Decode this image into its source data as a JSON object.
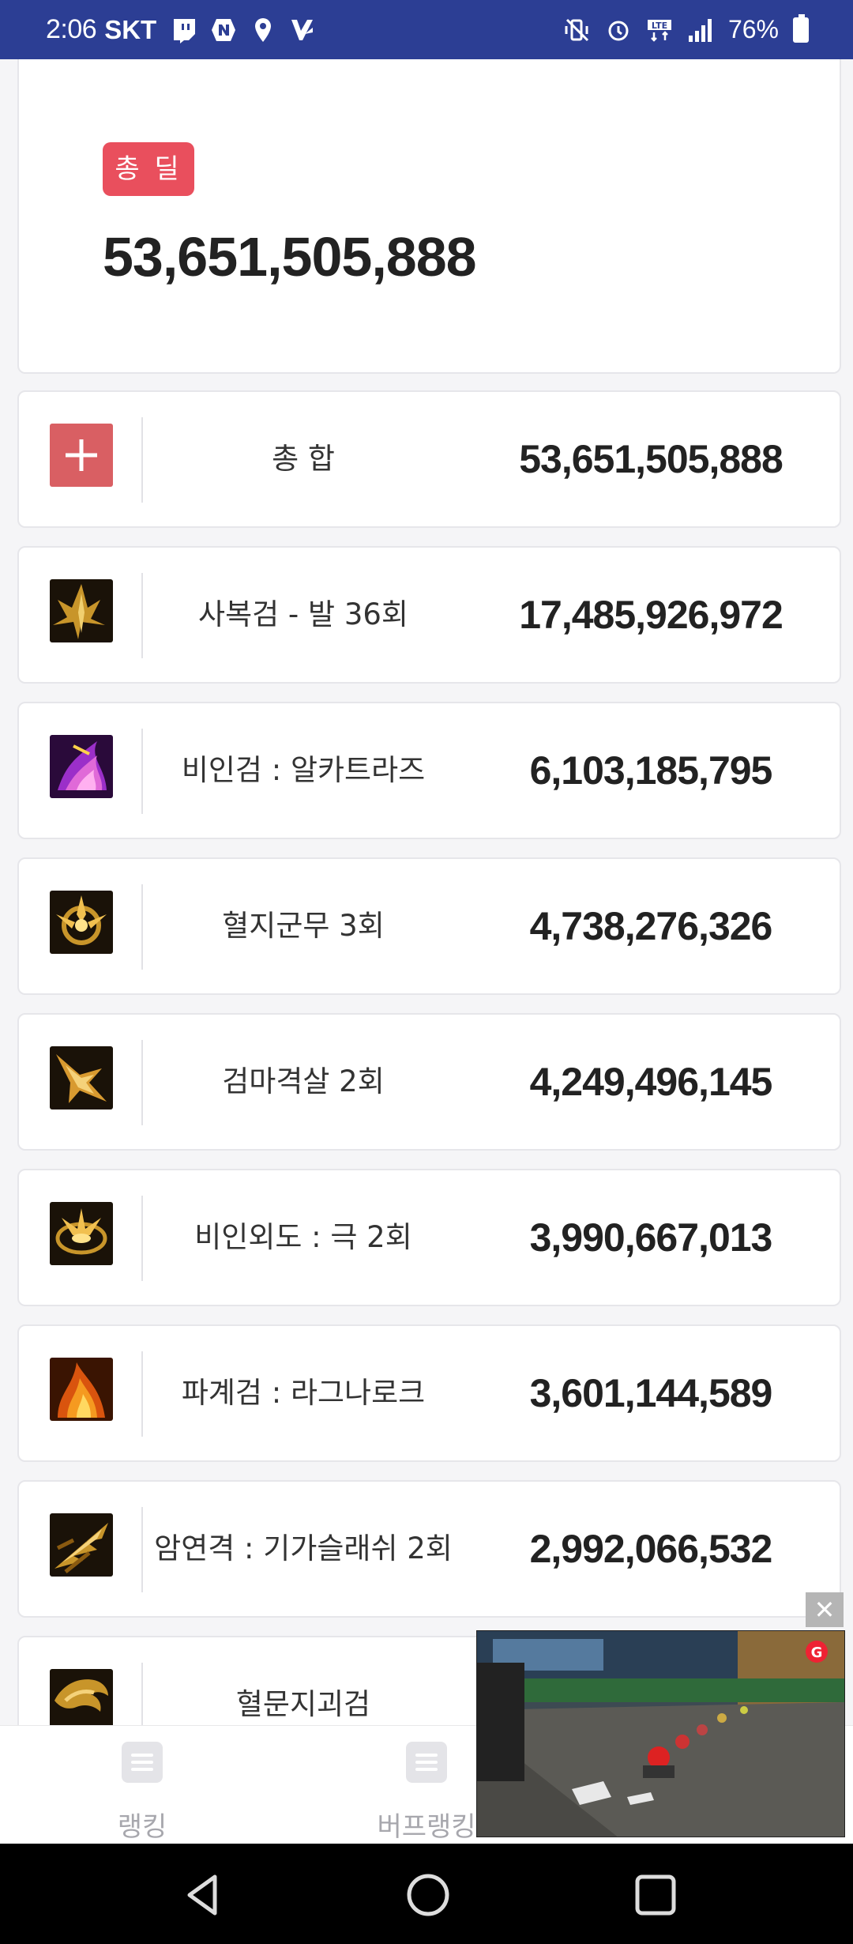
{
  "status_bar": {
    "time": "2:06",
    "carrier": "SKT",
    "left_icons": [
      "twitch-icon",
      "naver-icon",
      "location-icon",
      "v-app-icon"
    ],
    "right_icons": [
      "mute-vibrate-icon",
      "alarm-icon",
      "lte-icon",
      "signal-icon"
    ],
    "battery_percent": "76%"
  },
  "summary": {
    "badge_label": "총 딜",
    "total_value": "53,651,505,888"
  },
  "rows": [
    {
      "icon": "plus-icon",
      "name": "총 합",
      "value": "53,651,505,888"
    },
    {
      "icon": "skill-icon-gold-sword",
      "name": "사복검 - 발 36회",
      "value": "17,485,926,972"
    },
    {
      "icon": "skill-icon-purple-flame",
      "name": "비인검 : 알카트라즈",
      "value": "6,103,185,795"
    },
    {
      "icon": "skill-icon-gold-burst",
      "name": "혈지군무 3회",
      "value": "4,738,276,326"
    },
    {
      "icon": "skill-icon-gold-wing",
      "name": "검마격살 2회",
      "value": "4,249,496,145"
    },
    {
      "icon": "skill-icon-gold-shock",
      "name": "비인외도 : 극 2회",
      "value": "3,990,667,013"
    },
    {
      "icon": "skill-icon-orange-fire",
      "name": "파계검 : 라그나로크",
      "value": "3,601,144,589"
    },
    {
      "icon": "skill-icon-gold-slash",
      "name": "암연격 : 기가슬래쉬 2회",
      "value": "2,992,066,532"
    },
    {
      "icon": "skill-icon-gold-dragon",
      "name": "혈문지괴검",
      "value": ""
    }
  ],
  "bottom_nav": {
    "items": [
      {
        "label": "랭킹",
        "icon": "list-icon"
      },
      {
        "label": "버프랭킹",
        "icon": "list-icon"
      }
    ]
  },
  "video_ad": {
    "close_label": "✕",
    "badge": "G"
  },
  "system_nav": [
    "back-icon",
    "home-icon",
    "recents-icon"
  ]
}
